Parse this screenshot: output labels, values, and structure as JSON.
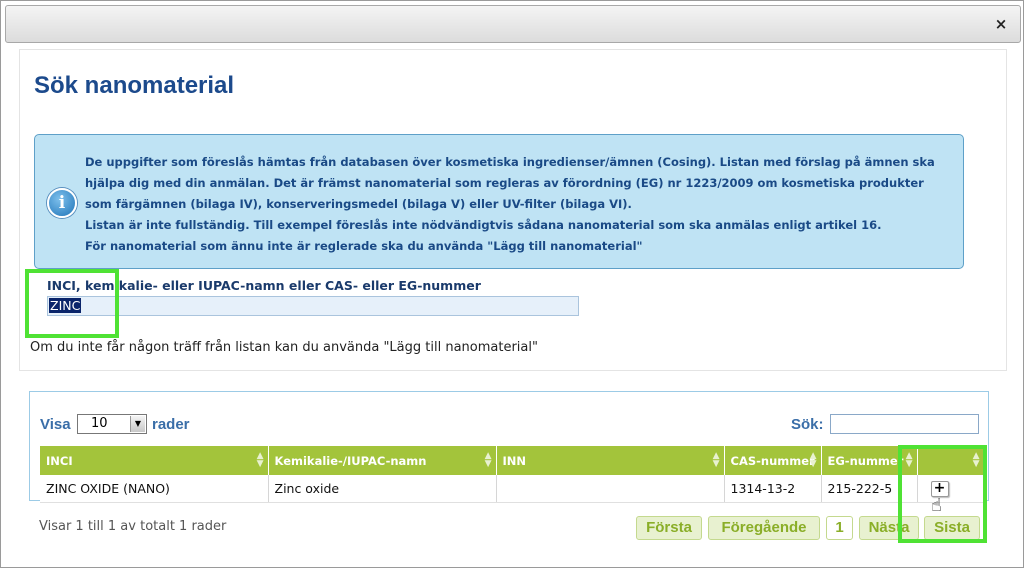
{
  "dialog": {
    "close_glyph": "×"
  },
  "page": {
    "title": "Sök nanomaterial"
  },
  "info": {
    "icon": "info-icon",
    "lines": [
      "De uppgifter som föreslås hämtas från databasen över kosmetiska ingredienser/ämnen (Cosing). Listan med förslag på ämnen ska",
      "hjälpa dig med din anmälan. Det är främst nanomaterial som regleras av förordning (EG) nr 1223/2009 om kosmetiska produkter",
      "som färgämnen (bilaga IV), konserveringsmedel (bilaga V) eller UV-filter (bilaga VI).",
      "Listan är inte fullständig. Till exempel föreslås inte nödvändigtvis sådana nanomaterial som ska anmälas enligt artikel 16.",
      "För nanomaterial som ännu inte är reglerade ska du använda \"Lägg till nanomaterial\""
    ]
  },
  "search": {
    "label": "INCI, kemikalie- eller IUPAC-namn eller CAS- eller EG-nummer",
    "value": "ZINC",
    "hint": "Om du inte får någon träff från listan kan du använda \"Lägg till nanomaterial\""
  },
  "grid": {
    "visa_label": "Visa",
    "length_value": "10",
    "rader_label": "rader",
    "sok_label": "Sök:",
    "sok_value": "",
    "columns": [
      "INCI",
      "Kemikalie-/IUPAC-namn",
      "INN",
      "CAS-nummer",
      "EG-nummer",
      ""
    ],
    "rows": [
      {
        "inci": "ZINC OXIDE (NANO)",
        "iupac": "Zinc oxide",
        "inn": "",
        "cas": "1314-13-2",
        "eg": "215-222-5",
        "action": "+"
      }
    ],
    "info": "Visar 1 till 1 av totalt 1 rader",
    "pager": {
      "first": "Första",
      "previous": "Föregående",
      "page": "1",
      "next": "Nästa",
      "last": "Sista"
    }
  },
  "colors": {
    "title": "#1c4a8c",
    "info_bg": "#bfe3f4",
    "header_green": "#a3c43b",
    "highlight": "#4fe234"
  }
}
